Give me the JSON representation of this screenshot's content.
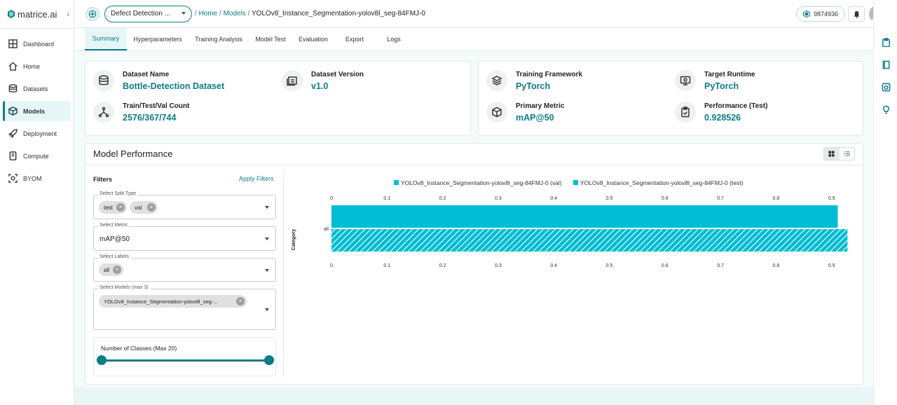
{
  "brand": {
    "name": "matrice.ai"
  },
  "sidebar": {
    "items": [
      {
        "label": "Dashboard",
        "icon": "grid-icon"
      },
      {
        "label": "Home",
        "icon": "home-icon"
      },
      {
        "label": "Datasets",
        "icon": "database-icon"
      },
      {
        "label": "Models",
        "icon": "cube-icon",
        "active": true
      },
      {
        "label": "Deployment",
        "icon": "rocket-icon"
      },
      {
        "label": "Compute",
        "icon": "server-icon"
      },
      {
        "label": "BYOM",
        "icon": "scan-icon"
      }
    ]
  },
  "header": {
    "project": "Defect Detection ...",
    "breadcrumb": {
      "home": "Home",
      "sep": "/",
      "models": "Models",
      "current": "YOLOv8_Instance_Segmentation-yolov8l_seg-84FMJ-0"
    },
    "credits": "9874936"
  },
  "tabs": [
    {
      "label": "Summary",
      "active": true
    },
    {
      "label": "Hyperparameters"
    },
    {
      "label": "Training Analysis"
    },
    {
      "label": "Model Test"
    },
    {
      "label": "Evaluation"
    },
    {
      "label": "Export"
    },
    {
      "label": "Logs"
    }
  ],
  "dataset_card": {
    "dataset_name": {
      "label": "Dataset Name",
      "value": "Bottle-Detection Dataset"
    },
    "dataset_version": {
      "label": "Dataset Version",
      "value": "v1.0"
    },
    "split_count": {
      "label": "Train/Test/Val Count",
      "value": "2576/367/744"
    }
  },
  "model_card": {
    "framework": {
      "label": "Training Framework",
      "value": "PyTorch"
    },
    "runtime": {
      "label": "Target Runtime",
      "value": "PyTorch"
    },
    "metric": {
      "label": "Primary Metric",
      "value": "mAP@50"
    },
    "performance": {
      "label": "Performance (Test)",
      "value": "0.928526"
    }
  },
  "performance": {
    "title": "Model Performance",
    "filters": {
      "title": "Filters",
      "apply": "Apply Filters",
      "split_type": {
        "label": "Select Split Type",
        "chips": [
          "test",
          "val"
        ]
      },
      "metric": {
        "label": "Select Metric",
        "value": "mAP@50"
      },
      "labels": {
        "label": "Select Labels",
        "chips": [
          "all"
        ]
      },
      "models": {
        "label": "Select Models (max 3)",
        "chips": [
          "YOLOv8_Instance_Segmentation-yolov8l_seg-..."
        ]
      },
      "classes": {
        "label": "Number of Classes (Max 20)"
      }
    }
  },
  "chart_data": {
    "type": "bar",
    "orientation": "horizontal",
    "categories": [
      "all"
    ],
    "ylabel": "Category",
    "xlim": [
      0,
      0.92
    ],
    "ticks_top": [
      "0",
      "0.1",
      "0.2",
      "0.3",
      "0.4",
      "0.5",
      "0.6",
      "0.7",
      "0.8",
      "0.9"
    ],
    "ticks_bottom": [
      "0",
      "0.1",
      "0.2",
      "0.3",
      "0.4",
      "0.5",
      "0.6",
      "0.7",
      "0.8",
      "0.9"
    ],
    "legend_position": "top",
    "series": [
      {
        "name": "YOLOv8_Instance_Segmentation-yolov8l_seg-84FMJ-0 (val)",
        "values": [
          0.911
        ],
        "color": "#00bcd4",
        "pattern": "solid"
      },
      {
        "name": "YOLOv8_Instance_Segmentation-yolov8l_seg-84FMJ-0 (test)",
        "values": [
          0.928526
        ],
        "color": "#00bcd4",
        "pattern": "hatched"
      }
    ]
  }
}
